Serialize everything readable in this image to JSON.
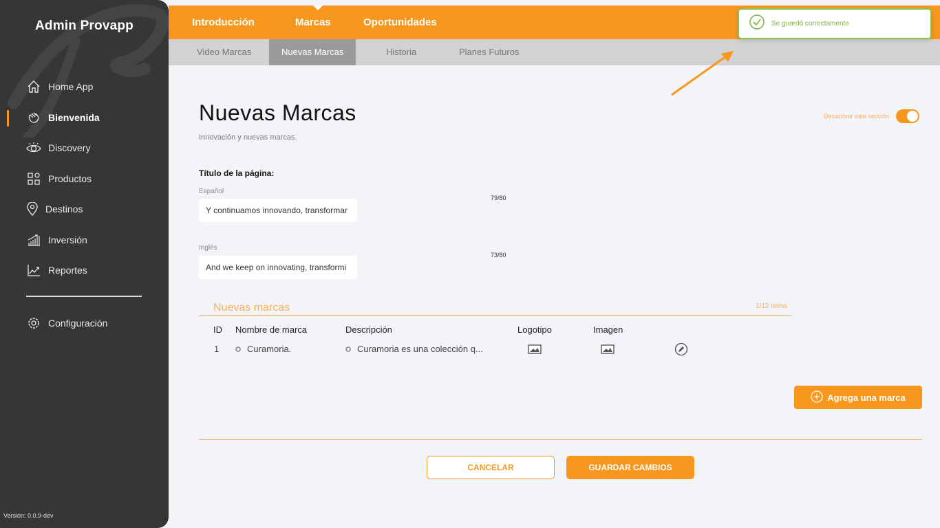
{
  "sidebar": {
    "app_title": "Admin Provapp",
    "items": [
      {
        "label": "Home App",
        "icon": "home-icon"
      },
      {
        "label": "Bienvenida",
        "icon": "waving-hand-icon",
        "active": true
      },
      {
        "label": "Discovery",
        "icon": "eye-icon"
      },
      {
        "label": "Productos",
        "icon": "grid-shapes-icon"
      },
      {
        "label": "Destinos",
        "icon": "location-pin-icon"
      },
      {
        "label": "Inversión",
        "icon": "bar-chart-icon"
      },
      {
        "label": "Reportes",
        "icon": "line-chart-icon"
      }
    ],
    "settings_label": "Configuración",
    "version": "Versión: 0.0.9-dev"
  },
  "topnav": {
    "tabs": [
      "Introducción",
      "Marcas",
      "Oportunidades"
    ],
    "active": "Marcas"
  },
  "subnav": {
    "tabs": [
      "Video Marcas",
      "Nuevas Marcas",
      "Historia",
      "Planes Futuros"
    ],
    "active": "Nuevas Marcas"
  },
  "toast": {
    "message": "Se guardó correctamente",
    "color": "#8bc34a"
  },
  "page": {
    "title": "Nuevas Marcas",
    "subtitle": "Innovación y nuevas marcas.",
    "toggle_label": "Desactivar esta sección",
    "toggle_on": true,
    "section_title": "Título de la página:",
    "fields": {
      "spanish": {
        "label": "Español",
        "value": "Y continuamos innovando, transformar",
        "count": "79/80"
      },
      "english": {
        "label": "Inglés",
        "value": "And we keep on innovating, transformi",
        "count": "73/80"
      }
    }
  },
  "brands": {
    "title": "Nuevas marcas",
    "count": "1/12 items",
    "headers": [
      "ID",
      "Nombre de marca",
      "Descripción",
      "Logotipo",
      "Imagen"
    ],
    "rows": [
      {
        "id": "1",
        "name": "Curamoria.",
        "description": "Curamoria es una colección q..."
      }
    ],
    "add_button": "Agrega una marca"
  },
  "actions": {
    "cancel": "CANCELAR",
    "save": "GUARDAR CAMBIOS"
  },
  "colors": {
    "accent": "#f7971e",
    "sidebar": "#363636",
    "success": "#8bc34a"
  }
}
